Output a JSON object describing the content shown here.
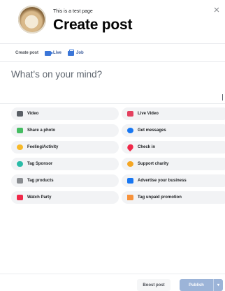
{
  "header": {
    "subtitle": "This is a test page",
    "title": "Create post",
    "close_icon": "close-icon"
  },
  "post_types": {
    "label": "Create post",
    "options": [
      {
        "label": "Live",
        "icon": "video-camera-icon"
      },
      {
        "label": "Job",
        "icon": "briefcase-icon"
      }
    ]
  },
  "composer": {
    "placeholder": "What's on your mind?"
  },
  "actions": [
    {
      "label": "Video",
      "icon": "video-icon",
      "color": "#5a5f66"
    },
    {
      "label": "Live Video",
      "icon": "live-video-icon",
      "color": "#e4405f"
    },
    {
      "label": "Share a photo",
      "icon": "photo-icon",
      "color": "#45bd62"
    },
    {
      "label": "Get messages",
      "icon": "messenger-icon",
      "color": "#1877f2"
    },
    {
      "label": "Feeling/Activity",
      "icon": "feeling-emoji-icon",
      "color": "#f7b928"
    },
    {
      "label": "Check in",
      "icon": "location-pin-icon",
      "color": "#f02849"
    },
    {
      "label": "Tag Sponsor",
      "icon": "handshake-icon",
      "color": "#2abba7"
    },
    {
      "label": "Support charity",
      "icon": "charity-icon",
      "color": "#f5a623"
    },
    {
      "label": "Tag products",
      "icon": "shopping-bag-icon",
      "color": "#8a8d91"
    },
    {
      "label": "Advertise your business",
      "icon": "megaphone-icon",
      "color": "#1877f2"
    },
    {
      "label": "Watch Party",
      "icon": "watch-party-icon",
      "color": "#f02849"
    },
    {
      "label": "Tag unpaid promotion",
      "icon": "flag-icon",
      "color": "#f7923b"
    }
  ],
  "footer": {
    "boost_label": "Boost post",
    "publish_label": "Publish",
    "caret": "▾"
  }
}
